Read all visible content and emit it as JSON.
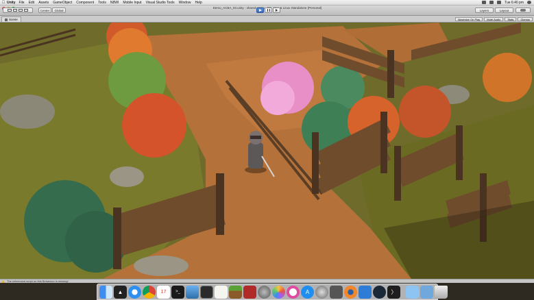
{
  "menubar": {
    "app_name": "Unity",
    "items": [
      "File",
      "Edit",
      "Assets",
      "GameObject",
      "Component",
      "Tools",
      "N8WI",
      "Mobile Input",
      "Visual Studio Tools",
      "Window",
      "Help"
    ],
    "clock": "Tue 6:40 pm"
  },
  "toolbar": {
    "window_title": "Demo_ACBA_03.unity - shared-origin - PC, Mac & Linux Standalone (Personal)",
    "left_buttons": [
      "Center",
      "Global"
    ],
    "right_buttons": [
      "Layers",
      "Layout"
    ]
  },
  "scene": {
    "tab_label": "Scene",
    "info": [
      "Maximize On Play",
      "Mute Audio",
      "Stats",
      "Gizmos"
    ]
  },
  "status": {
    "message": "The referenced script on this Behaviour is missing!"
  },
  "dock": {
    "icons": [
      "finder-icon",
      "unity-icon",
      "safari-icon",
      "chrome-icon",
      "calendar-icon",
      "terminal-icon",
      "preview-icon",
      "unity-hub-icon",
      "textedit-icon",
      "minecraft-icon",
      "game-icon",
      "rocket-icon",
      "photos-icon",
      "itunes-icon",
      "app-store-icon",
      "system-preferences-icon",
      "vlc-icon",
      "blender-icon",
      "xcode-icon",
      "steam-icon",
      "visual-studio-icon",
      "folder-icon",
      "downloads-icon",
      "trash-icon"
    ]
  }
}
